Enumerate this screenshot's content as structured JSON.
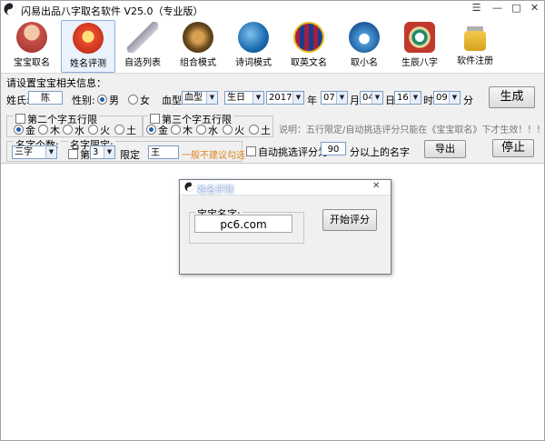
{
  "window": {
    "title": "闪易出品八字取名软件 V25.0（专业版）",
    "controls": [
      "☰",
      "—",
      "□",
      "✕"
    ]
  },
  "toolbar": {
    "items": [
      {
        "label": "宝宝取名",
        "icon": "baby-icon",
        "color": "#c7504a"
      },
      {
        "label": "姓名评测",
        "icon": "fortune-icon",
        "color": "#d63a2a"
      },
      {
        "label": "自选列表",
        "icon": "brush-icon",
        "color": "#8a8a9a"
      },
      {
        "label": "组合模式",
        "icon": "lion-icon",
        "color": "#6b4a1e"
      },
      {
        "label": "诗词模式",
        "icon": "book-icon",
        "color": "#1a6ab0"
      },
      {
        "label": "取英文名",
        "icon": "barcelona-icon",
        "color": "#a02040"
      },
      {
        "label": "取小名",
        "icon": "snowman-icon",
        "color": "#1e5a9a"
      },
      {
        "label": "生辰八字",
        "icon": "bagua-icon",
        "color": "#1f8a6a"
      },
      {
        "label": "软件注册",
        "icon": "lock-icon",
        "color": "#d8a21e"
      }
    ],
    "active": 1
  },
  "form": {
    "heading": "请设置宝宝相关信息：",
    "surname_label": "姓氏:",
    "surname_value": "陈",
    "gender_label": "性别:",
    "gender_male": "男",
    "gender_female": "女",
    "blood_label": "血型:",
    "blood_value": "血型",
    "birth_type": "生日",
    "year": "2017",
    "year_unit": "年",
    "month": "07",
    "month_unit": "月",
    "day": "04",
    "day_unit": "日",
    "hour": "16",
    "hour_unit": "时",
    "minute": "09",
    "minute_unit": "分",
    "generate_button": "生成",
    "second_char_group": "第二个字五行限",
    "third_char_group": "第三个字五行限",
    "elements": [
      "金",
      "木",
      "水",
      "火",
      "土"
    ],
    "note": "说明：五行限定/自动挑选评分只能在《宝宝取名》下才生效！！！！！",
    "name_count_label": "名字个数:",
    "name_count_value": "三字",
    "name_limit_label": "名字限定:",
    "position_prefix": "第",
    "position_value": "3",
    "limit_label": "限定",
    "limit_char": "王",
    "limit_warning": "一般不建议勾选",
    "auto_score_label": "自动挑选评分为:",
    "auto_score_value": "90",
    "auto_score_suffix": "分以上的名字",
    "export_button": "导出",
    "stop_button": "停止"
  },
  "dialog": {
    "title": "姓名评测",
    "group_label": "宝宝名字:",
    "name_value": "pc6.com",
    "start_button": "开始评分",
    "close": "✕"
  }
}
